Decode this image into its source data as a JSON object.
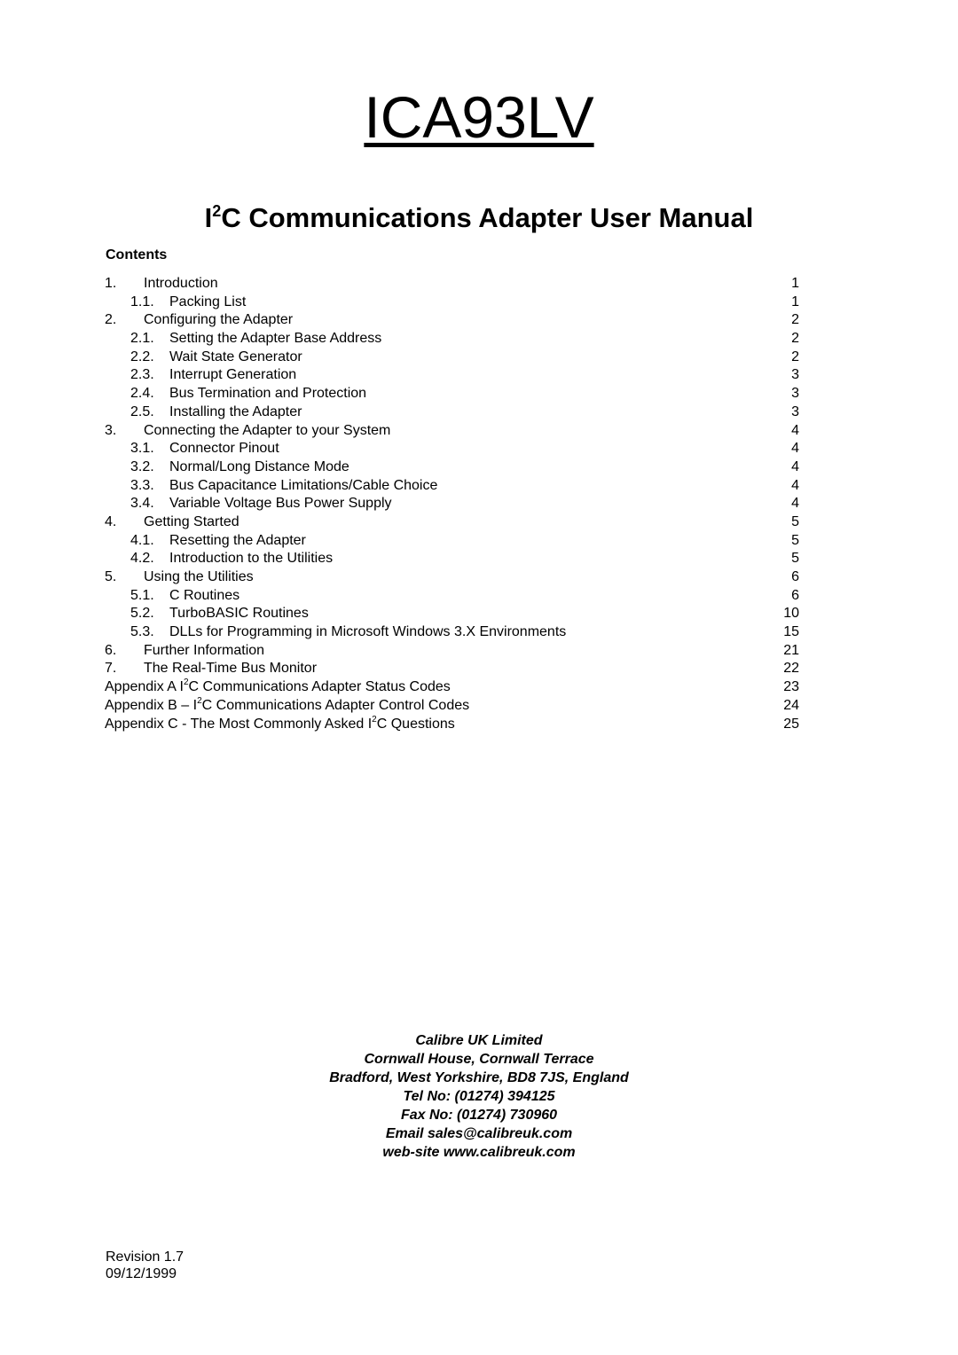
{
  "document": {
    "title": "ICA93LV",
    "subtitle_prefix": "I",
    "subtitle_sup": "2",
    "subtitle_rest": "C Communications Adapter User Manual",
    "contents_heading": "Contents"
  },
  "toc": [
    {
      "num": "1.",
      "text": "Introduction",
      "page": "1",
      "level": 1
    },
    {
      "num": "1.1.",
      "text": "Packing List",
      "page": "1",
      "level": 2
    },
    {
      "num": "2.",
      "text": "Configuring the Adapter",
      "page": "2",
      "level": 1
    },
    {
      "num": "2.1.",
      "text": "Setting the Adapter Base Address",
      "page": "2",
      "level": 2
    },
    {
      "num": "2.2.",
      "text": "Wait State Generator",
      "page": "2",
      "level": 2
    },
    {
      "num": "2.3.",
      "text": "Interrupt Generation",
      "page": "3",
      "level": 2
    },
    {
      "num": "2.4.",
      "text": "Bus Termination and Protection",
      "page": "3",
      "level": 2
    },
    {
      "num": "2.5.",
      "text": "Installing the Adapter",
      "page": "3",
      "level": 2
    },
    {
      "num": "3.",
      "text": "Connecting the Adapter to your System",
      "page": "4",
      "level": 1
    },
    {
      "num": "3.1.",
      "text": "Connector Pinout",
      "page": "4",
      "level": 2
    },
    {
      "num": "3.2.",
      "text": "Normal/Long Distance Mode",
      "page": "4",
      "level": 2
    },
    {
      "num": "3.3.",
      "text": "Bus Capacitance Limitations/Cable Choice",
      "page": "4",
      "level": 2
    },
    {
      "num": "3.4.",
      "text": "Variable Voltage Bus Power Supply",
      "page": "4",
      "level": 2
    },
    {
      "num": "4.",
      "text": "Getting Started",
      "page": "5",
      "level": 1
    },
    {
      "num": "4.1.",
      "text": "Resetting the Adapter",
      "page": "5",
      "level": 2
    },
    {
      "num": "4.2.",
      "text": "Introduction to the Utilities",
      "page": "5",
      "level": 2
    },
    {
      "num": "5.",
      "text": "Using the Utilities",
      "page": "6",
      "level": 1
    },
    {
      "num": "5.1.",
      "text": "C Routines",
      "page": "6",
      "level": 2
    },
    {
      "num": "5.2.",
      "text": "TurboBASIC Routines",
      "page": "10",
      "level": 2
    },
    {
      "num": "5.3.",
      "text": "DLLs for Programming in Microsoft Windows 3.X Environments",
      "page": "15",
      "level": 2
    },
    {
      "num": "6.",
      "text": "Further Information",
      "page": "21",
      "level": 1
    },
    {
      "num": "7.",
      "text": "The Real-Time Bus Monitor",
      "page": "22",
      "level": 1
    },
    {
      "num": "",
      "text_pre": "Appendix A I",
      "sup": "2",
      "text_post": "C Communications Adapter Status Codes",
      "page": "23",
      "level": 0
    },
    {
      "num": "",
      "text_pre": "Appendix B – I",
      "sup": "2",
      "text_post": "C Communications Adapter Control Codes",
      "page": "24",
      "level": 0
    },
    {
      "num": "",
      "text_pre": "Appendix C - The Most Commonly Asked I",
      "sup": "2",
      "text_post": "C Questions",
      "page": "25",
      "level": 0
    }
  ],
  "address": {
    "lines": [
      "Calibre UK Limited",
      "Cornwall House, Cornwall Terrace",
      "Bradford, West Yorkshire, BD8 7JS, England",
      "Tel No: (01274) 394125",
      "Fax No: (01274) 730960",
      "Email sales@calibreuk.com",
      "web-site www.calibreuk.com"
    ]
  },
  "revision": {
    "label": "Revision 1.7",
    "date": "09/12/1999"
  }
}
